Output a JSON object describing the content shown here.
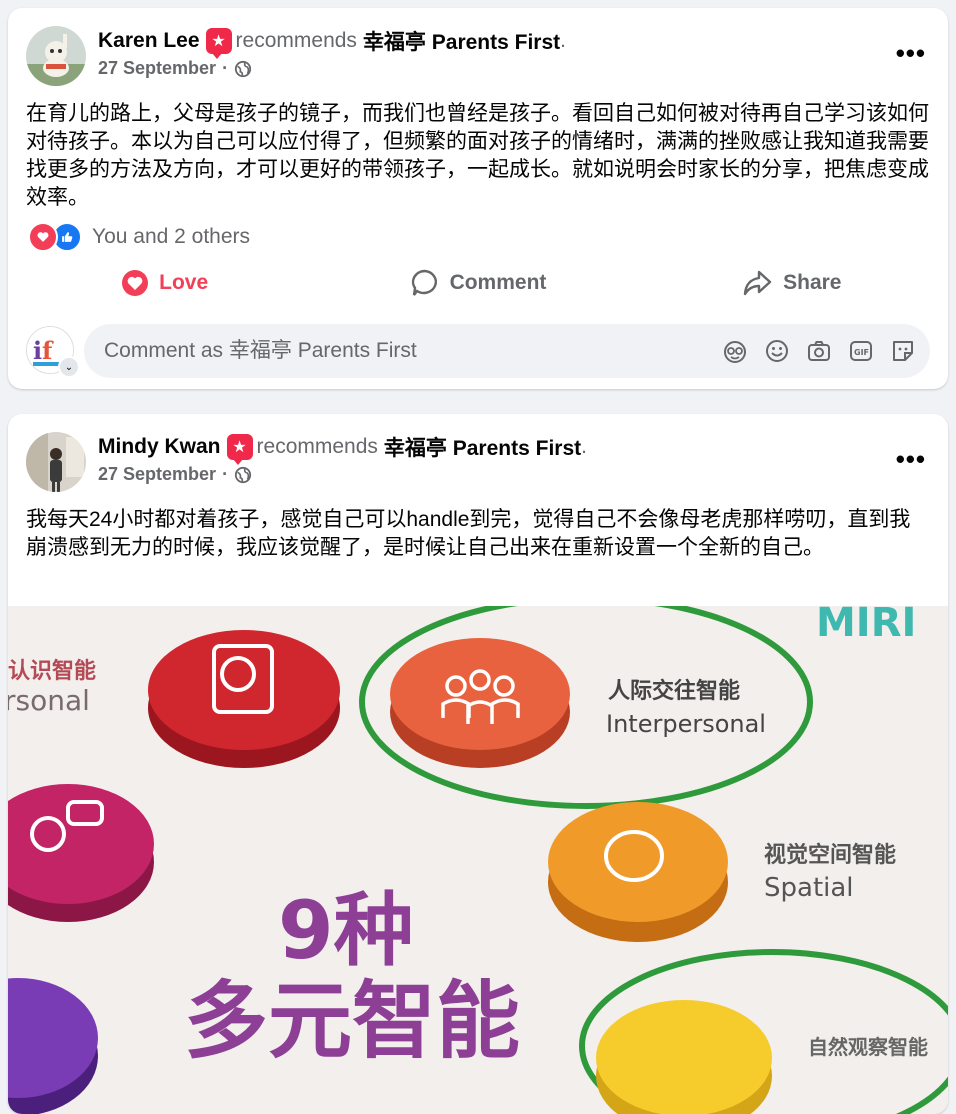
{
  "posts": [
    {
      "author": "Karen Lee",
      "verb": "recommends",
      "page": "幸福亭 Parents First",
      "period": ".",
      "date": "27 September",
      "dot": "·",
      "text": "在育儿的路上，父母是孩子的镜子，而我们也曾经是孩子。看回自己如何被对待再自己学习该如何对待孩子。本以为自己可以应付得了，但频繁的面对孩子的情绪时，满满的挫败感让我知道我需要找更多的方法及方向，才可以更好的带领孩子，一起成长。就如说明会时家长的分享，把焦虑变成效率。",
      "reactions_text": "You and 2 others",
      "actions": {
        "love": "Love",
        "comment": "Comment",
        "share": "Share"
      },
      "comment_placeholder": "Comment as 幸福亭 Parents First"
    },
    {
      "author": "Mindy Kwan",
      "verb": "recommends",
      "page": "幸福亭 Parents First",
      "period": ".",
      "date": "27 September",
      "dot": "·",
      "text": "我每天24小时都对着孩子，感觉自己可以handle到完，觉得自己不会像母老虎那样唠叨，直到我崩溃感到无力的时候，我应该觉醒了，是时候让自己出来在重新设置一个全新的自己。"
    }
  ],
  "image": {
    "labels": {
      "intrapersonal_cn": "认识智能",
      "intrapersonal_en": "rsonal",
      "interpersonal_cn": "人际交往智能",
      "interpersonal_en": "Interpersonal",
      "spatial_cn": "视觉空间智能",
      "spatial_en": "Spatial",
      "naturalist_cn": "自然观察智能",
      "title_line1": "9种",
      "title_line2": "多元智能",
      "corner_text": "MIRI"
    }
  },
  "colors": {
    "love": "#f33e58",
    "like": "#1877f2",
    "muted": "#65676b",
    "recommend_badge": "#f02849"
  },
  "icons": [
    "more-icon",
    "globe-icon",
    "heart-icon",
    "like-icon",
    "comment-icon",
    "share-icon",
    "avatar-sticker-icon",
    "emoji-icon",
    "camera-icon",
    "gif-icon",
    "sticker-icon"
  ]
}
